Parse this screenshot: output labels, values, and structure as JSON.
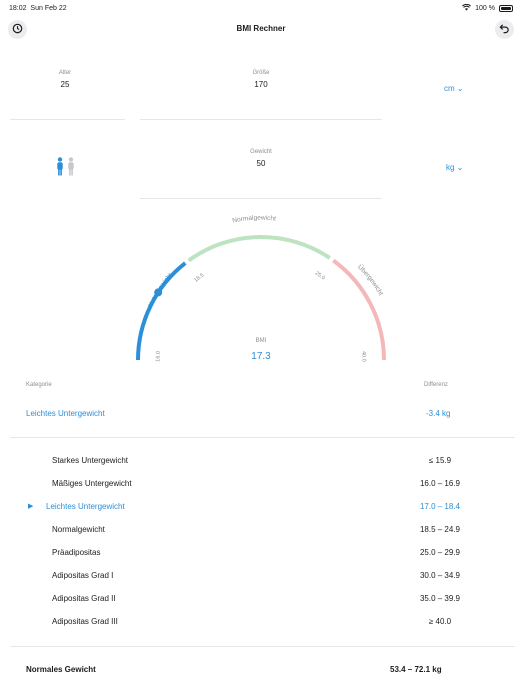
{
  "status": {
    "time": "18:02",
    "date": "Sun Feb 22",
    "battery": "100 %"
  },
  "nav": {
    "title": "BMI Rechner"
  },
  "inputs": {
    "age": {
      "label": "Alter",
      "value": "25"
    },
    "height": {
      "label": "Größe",
      "value": "170",
      "unit": "cm ⌄"
    },
    "weight": {
      "label": "Gewicht",
      "value": "50",
      "unit": "kg ⌄"
    }
  },
  "gauge": {
    "labels": {
      "under": "Untergewicht",
      "normal": "Normalgewicht",
      "over": "Übergewicht"
    },
    "ticks": [
      "16.0",
      "18.5",
      "25.0",
      "40.0"
    ],
    "bmi_label": "BMI",
    "bmi_value": "17.3",
    "bmi_number": 17.3,
    "colors": {
      "under": "#2b8fd9",
      "normal": "#bde3c0",
      "over": "#f4b8b8"
    }
  },
  "category": {
    "label_header": "Kategorie",
    "diff_header": "Differenz",
    "value": "Leichtes Untergewicht",
    "diff": "-3.4 kg"
  },
  "table": [
    {
      "name": "Starkes Untergewicht",
      "range": "≤ 15.9",
      "active": false
    },
    {
      "name": "Mäßiges Untergewicht",
      "range": "16.0 – 16.9",
      "active": false
    },
    {
      "name": "Leichtes Untergewicht",
      "range": "17.0 – 18.4",
      "active": true
    },
    {
      "name": "Normalgewicht",
      "range": "18.5 – 24.9",
      "active": false
    },
    {
      "name": "Präadipositas",
      "range": "25.0 – 29.9",
      "active": false
    },
    {
      "name": "Adipositas Grad I",
      "range": "30.0 – 34.9",
      "active": false
    },
    {
      "name": "Adipositas Grad II",
      "range": "35.0 – 39.9",
      "active": false
    },
    {
      "name": "Adipositas Grad III",
      "range": "≥ 40.0",
      "active": false
    }
  ],
  "normal_weight": {
    "label": "Normales Gewicht",
    "value": "53.4 – 72.1 kg"
  }
}
